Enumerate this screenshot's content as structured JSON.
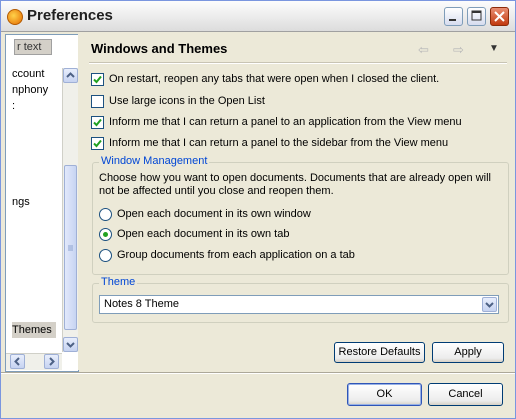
{
  "window": {
    "title": "Preferences"
  },
  "sidebar": {
    "filter_text": "r text",
    "items": [
      "ccount",
      "nphony",
      ":",
      "ngs",
      "Themes"
    ]
  },
  "page": {
    "title": "Windows and Themes",
    "nav": {
      "back": "⇦",
      "forward": "⇨",
      "menu": "▼"
    },
    "checkboxes": [
      {
        "label": "On restart, reopen any tabs that were open when I closed the client.",
        "checked": true
      },
      {
        "label": "Use large icons in the Open List",
        "checked": false
      },
      {
        "label": "Inform me that I can return a panel to an application from the View menu",
        "checked": true
      },
      {
        "label": "Inform me that I can return a panel to the sidebar from the View menu",
        "checked": true
      }
    ],
    "window_management": {
      "title": "Window Management",
      "description": "Choose how you want to open documents.  Documents that are already open will not be affected until you close and reopen them.",
      "options": [
        {
          "label": "Open each document in its own window",
          "selected": false
        },
        {
          "label": "Open each document in its own tab",
          "selected": true
        },
        {
          "label": "Group documents from each application on a tab",
          "selected": false
        }
      ]
    },
    "theme": {
      "title": "Theme",
      "value": "Notes 8 Theme"
    },
    "restore_defaults_label": "Restore Defaults",
    "apply_label": "Apply"
  },
  "footer": {
    "ok_label": "OK",
    "cancel_label": "Cancel"
  }
}
